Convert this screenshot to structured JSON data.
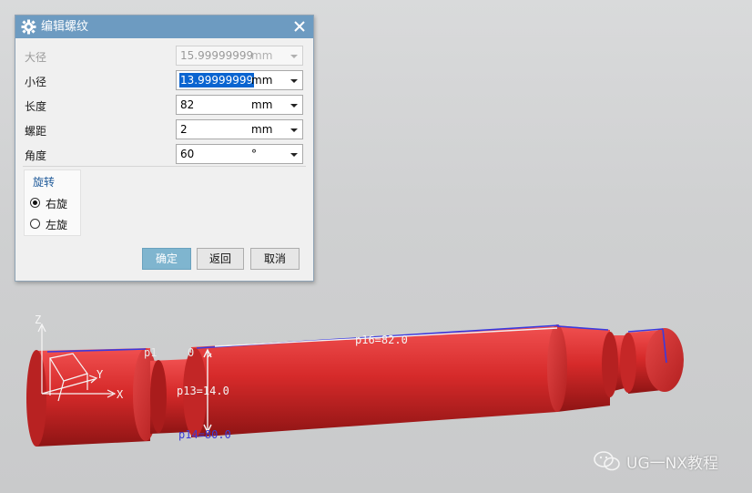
{
  "dialog": {
    "title": "编辑螺纹",
    "icons": {
      "settings": "gear-icon",
      "close": "close-icon"
    },
    "fields": [
      {
        "label": "大径",
        "value": "15.99999999",
        "unit": "mm",
        "disabled": true
      },
      {
        "label": "小径",
        "value": "13.99999999",
        "unit": "mm",
        "selected": true
      },
      {
        "label": "长度",
        "value": "82",
        "unit": "mm"
      },
      {
        "label": "螺距",
        "value": "2",
        "unit": "mm"
      },
      {
        "label": "角度",
        "value": "60",
        "unit": "°"
      }
    ],
    "rotation": {
      "title": "旋转",
      "options": [
        {
          "label": "右旋",
          "checked": true
        },
        {
          "label": "左旋",
          "checked": false
        }
      ]
    },
    "buttons": {
      "ok": "确定",
      "back": "返回",
      "cancel": "取消"
    }
  },
  "viewport": {
    "axes": {
      "z": "Z",
      "y": "Y",
      "x": "X"
    },
    "annotations": {
      "left_top": "p1",
      "left_top_suffix": "0",
      "main": "p16=82.0",
      "middle": "p13=14.0",
      "bottom": "p14=80.0"
    },
    "colors": {
      "part": "#d42a2a",
      "annotation": "#3b3bd6",
      "edge": "#3a3adf"
    }
  },
  "watermark": {
    "text": "UG一NX教程",
    "icon": "wechat-icon"
  }
}
